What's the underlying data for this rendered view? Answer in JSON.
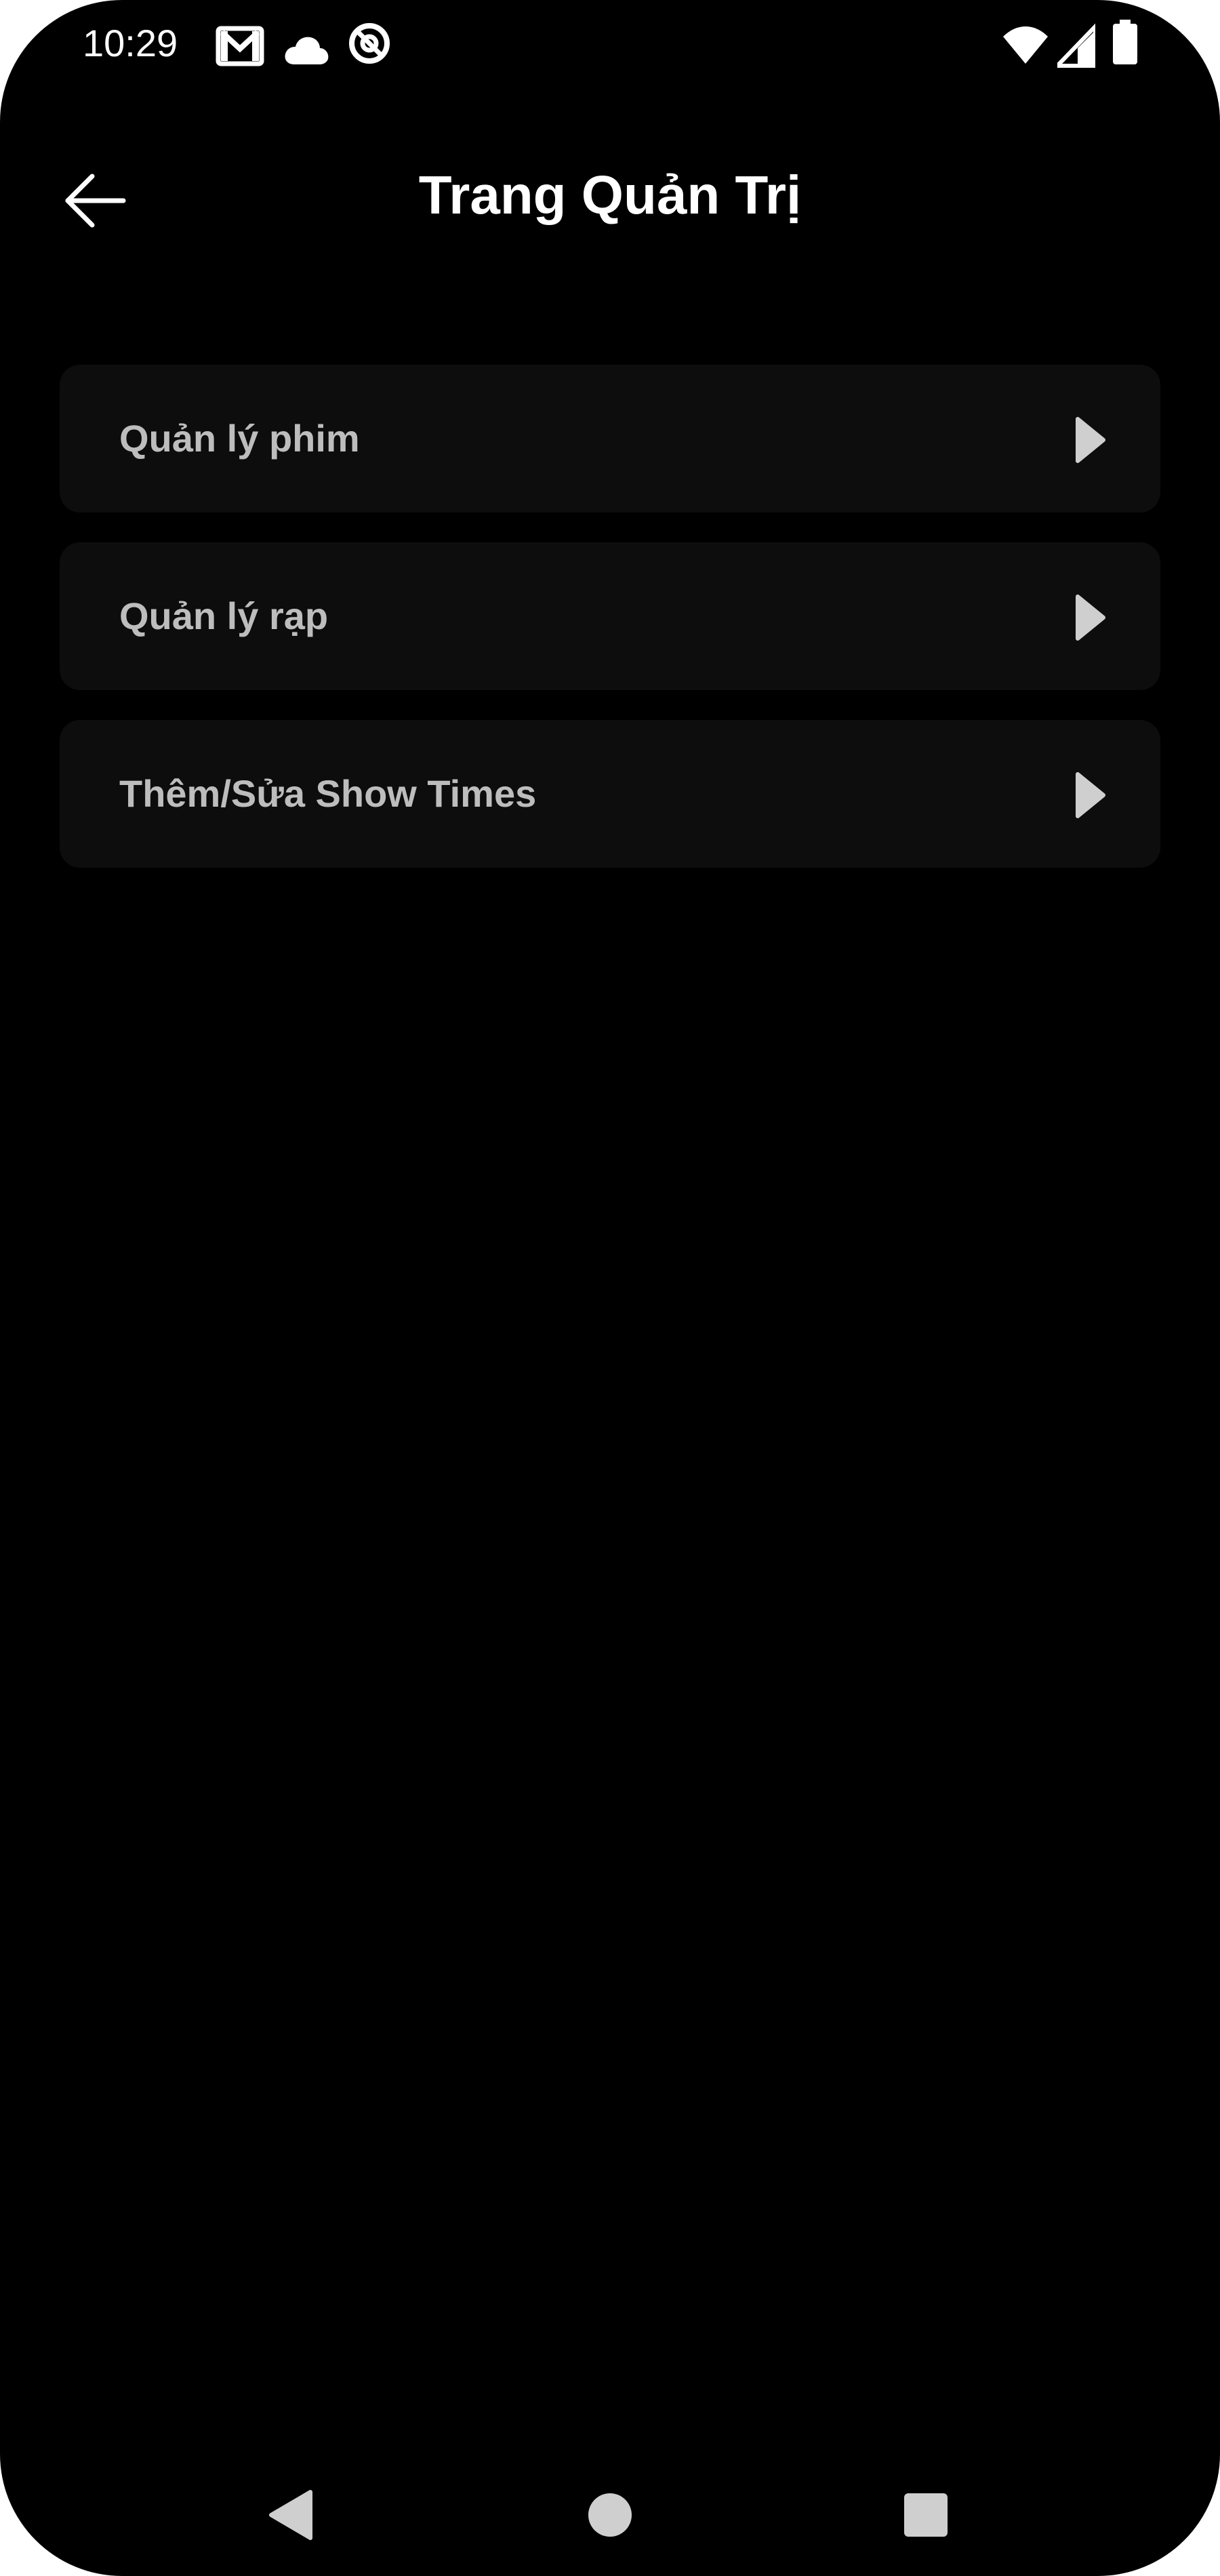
{
  "status_bar": {
    "time": "10:29",
    "left_icons": [
      "gmail-icon",
      "cloud-icon",
      "at-sign-icon"
    ],
    "right_icons": [
      "wifi-icon",
      "signal-icon",
      "battery-icon"
    ]
  },
  "header": {
    "title": "Trang Quản Trị",
    "back_icon": "arrow-back-icon"
  },
  "menu": {
    "items": [
      {
        "label": "Quản lý phim",
        "icon": "play-arrow-icon"
      },
      {
        "label": "Quản lý rạp",
        "icon": "play-arrow-icon"
      },
      {
        "label": "Thêm/Sửa Show Times",
        "icon": "play-arrow-icon"
      }
    ]
  },
  "nav_bar": {
    "items": [
      "nav-back-icon",
      "nav-home-icon",
      "nav-recents-icon"
    ]
  },
  "colors": {
    "background": "#000000",
    "card": "#0d0d0d",
    "title": "#ffffff",
    "item_text": "#bdbdbd",
    "icon": "#cfcfcf"
  }
}
